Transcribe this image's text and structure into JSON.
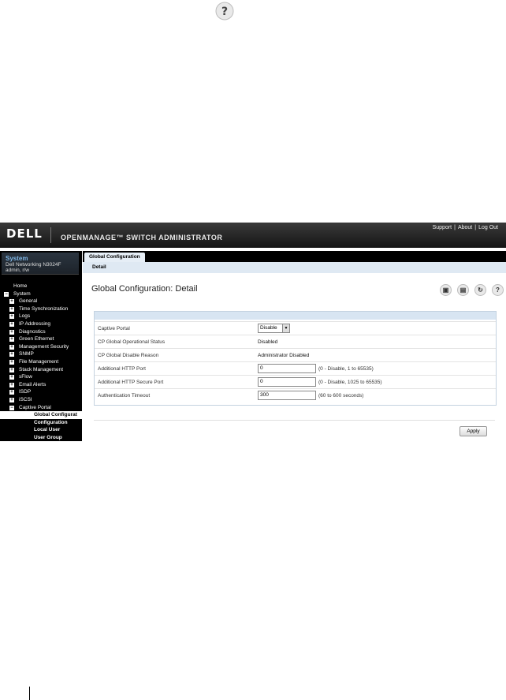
{
  "header": {
    "logo": "DELL",
    "product": "OPENMANAGE™ SWITCH ADMINISTRATOR",
    "links": [
      "Support",
      "About",
      "Log Out"
    ]
  },
  "system": {
    "title": "System",
    "model": "Dell Networking N3024F",
    "user": "admin, r/w"
  },
  "tree": [
    {
      "label": "Home",
      "exp": "",
      "indent": 0
    },
    {
      "label": "System",
      "exp": "−",
      "indent": 0
    },
    {
      "label": "General",
      "exp": "+",
      "indent": 1
    },
    {
      "label": "Time Synchronization",
      "exp": "+",
      "indent": 1
    },
    {
      "label": "Logs",
      "exp": "+",
      "indent": 1
    },
    {
      "label": "IP Addressing",
      "exp": "+",
      "indent": 1
    },
    {
      "label": "Diagnostics",
      "exp": "+",
      "indent": 1
    },
    {
      "label": "Green Ethernet",
      "exp": "+",
      "indent": 1
    },
    {
      "label": "Management Security",
      "exp": "+",
      "indent": 1
    },
    {
      "label": "SNMP",
      "exp": "+",
      "indent": 1
    },
    {
      "label": "File Management",
      "exp": "+",
      "indent": 1
    },
    {
      "label": "Stack Management",
      "exp": "+",
      "indent": 1
    },
    {
      "label": "sFlow",
      "exp": "+",
      "indent": 1
    },
    {
      "label": "Email Alerts",
      "exp": "+",
      "indent": 1
    },
    {
      "label": "ISDP",
      "exp": "+",
      "indent": 1
    },
    {
      "label": "iSCSI",
      "exp": "+",
      "indent": 1
    },
    {
      "label": "Captive Portal",
      "exp": "−",
      "indent": 1
    },
    {
      "label": "Global Configurat",
      "exp": "",
      "indent": 2,
      "selected": true
    },
    {
      "label": "Configuration",
      "exp": "",
      "indent": 2
    },
    {
      "label": "Local User",
      "exp": "",
      "indent": 2
    },
    {
      "label": "User Group",
      "exp": "",
      "indent": 2
    }
  ],
  "tabs": {
    "main": "Global Configuration",
    "sub": "Detail"
  },
  "page": {
    "title": "Global Configuration: Detail",
    "icons": [
      "save-icon",
      "print-icon",
      "refresh-icon",
      "help-icon"
    ]
  },
  "form": {
    "captive_portal": {
      "label": "Captive Portal",
      "value": "Disable"
    },
    "op_status": {
      "label": "CP Global Operational Status",
      "value": "Disabled"
    },
    "disable_reason": {
      "label": "CP Global Disable Reason",
      "value": "Administrator Disabled"
    },
    "http_port": {
      "label": "Additional HTTP Port",
      "value": "0",
      "hint": "(0 - Disable, 1 to 65535)"
    },
    "https_port": {
      "label": "Additional HTTP Secure Port",
      "value": "0",
      "hint": "(0 - Disable, 1025 to 65535)"
    },
    "auth_timeout": {
      "label": "Authentication Timeout",
      "value": "300",
      "hint": "(60 to 600 seconds)"
    }
  },
  "apply_label": "Apply",
  "help_glyph": "?"
}
